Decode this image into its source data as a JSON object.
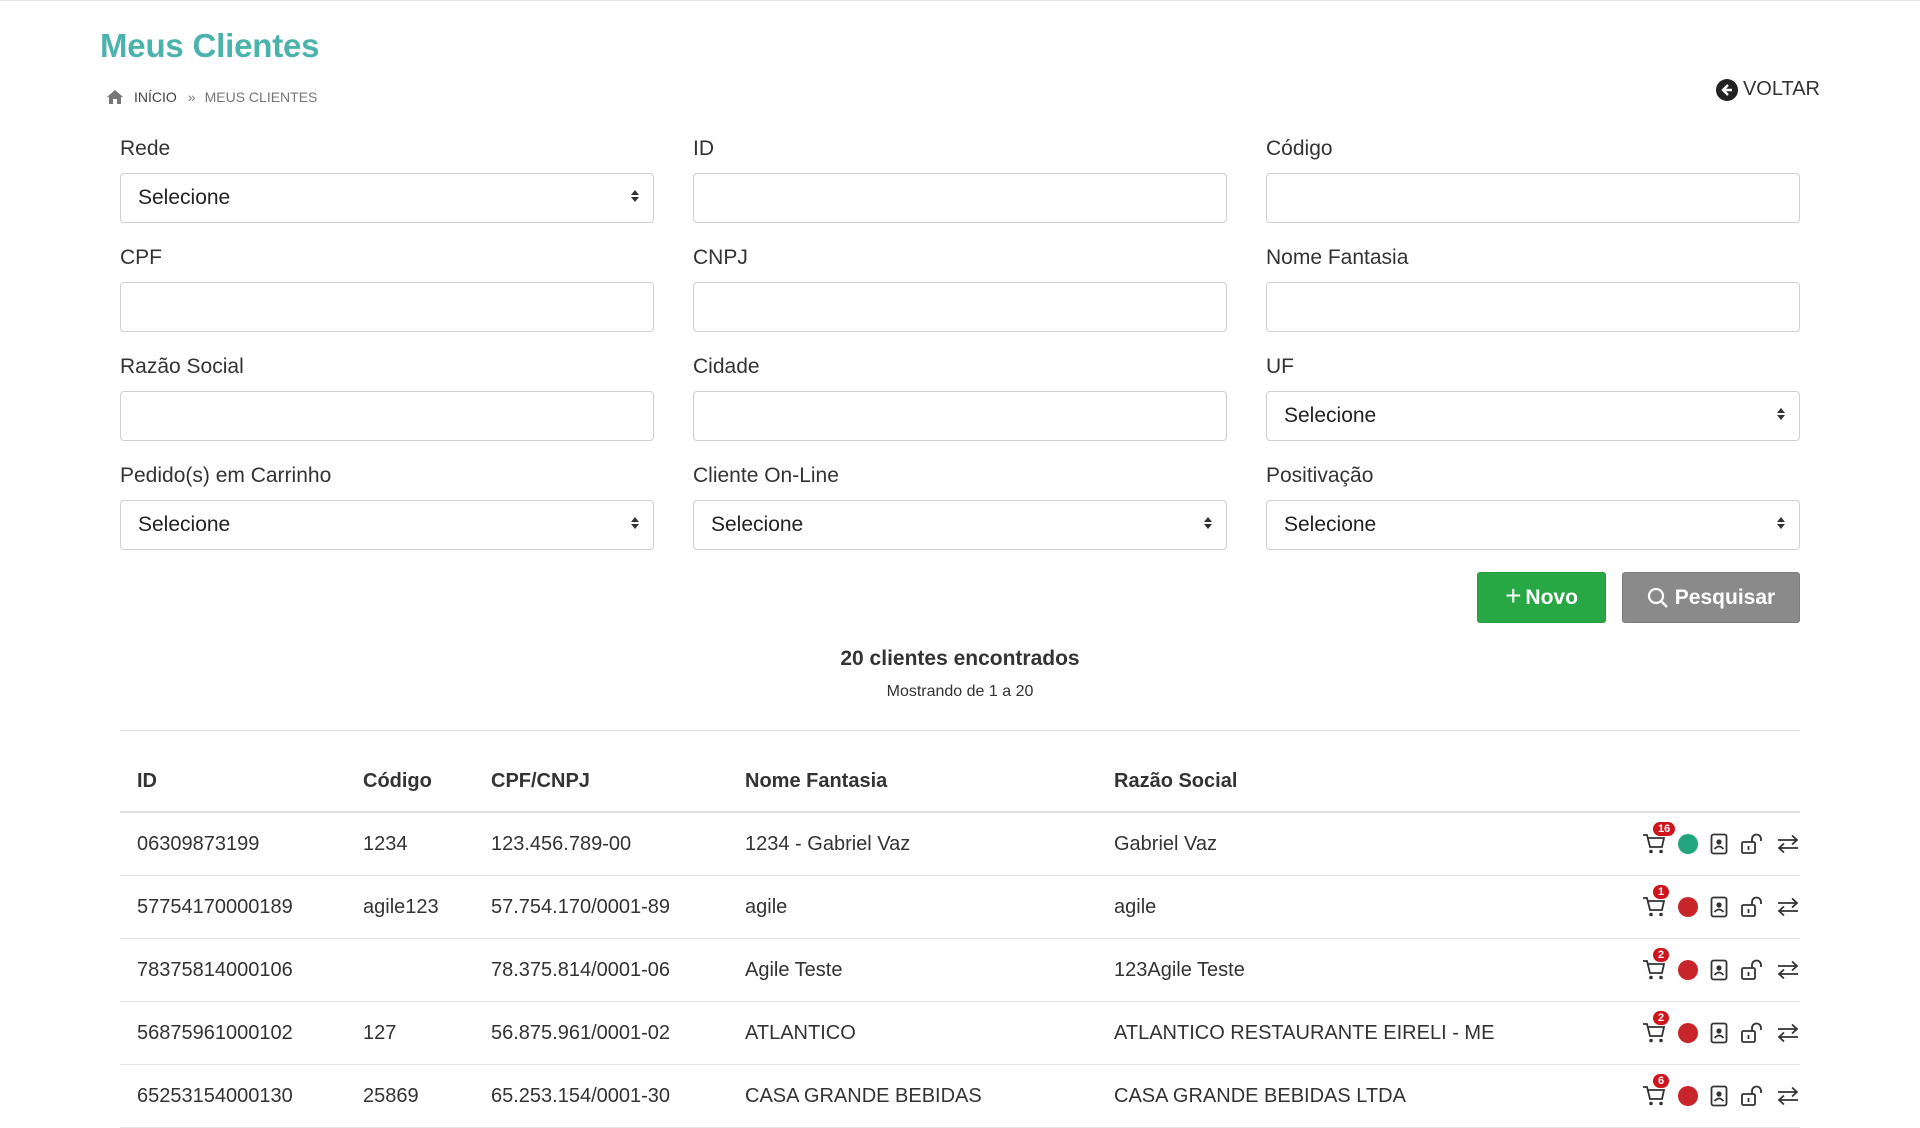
{
  "page": {
    "title": "Meus Clientes"
  },
  "breadcrumb": {
    "home": "INÍCIO",
    "current": "MEUS CLIENTES"
  },
  "back": {
    "label": "VOLTAR"
  },
  "filters": {
    "rede": {
      "label": "Rede",
      "value": "Selecione"
    },
    "id": {
      "label": "ID",
      "value": ""
    },
    "codigo": {
      "label": "Código",
      "value": ""
    },
    "cpf": {
      "label": "CPF",
      "value": ""
    },
    "cnpj": {
      "label": "CNPJ",
      "value": ""
    },
    "nome_fantasia": {
      "label": "Nome Fantasia",
      "value": ""
    },
    "razao_social": {
      "label": "Razão Social",
      "value": ""
    },
    "cidade": {
      "label": "Cidade",
      "value": ""
    },
    "uf": {
      "label": "UF",
      "value": "Selecione"
    },
    "pedidos_carrinho": {
      "label": "Pedido(s) em Carrinho",
      "value": "Selecione"
    },
    "cliente_online": {
      "label": "Cliente On-Line",
      "value": "Selecione"
    },
    "positivacao": {
      "label": "Positivação",
      "value": "Selecione"
    }
  },
  "buttons": {
    "new": "Novo",
    "search": "Pesquisar"
  },
  "results": {
    "count": "20 clientes encontrados",
    "range": "Mostrando de 1 a 20"
  },
  "colors": {
    "title": "#4bb3ab",
    "online": "#20a57f",
    "offline": "#c8252b",
    "badge": "#d0141c",
    "new_button": "#28a745",
    "search_button": "#8a8a8a"
  },
  "table": {
    "headers": [
      "ID",
      "Código",
      "CPF/CNPJ",
      "Nome Fantasia",
      "Razão Social"
    ],
    "rows": [
      {
        "id": "06309873199",
        "codigo": "1234",
        "doc": "123.456.789-00",
        "fantasia": "1234 - Gabriel Vaz",
        "razao": "Gabriel Vaz",
        "cart_count": "16",
        "online": true
      },
      {
        "id": "57754170000189",
        "codigo": "agile123",
        "doc": "57.754.170/0001-89",
        "fantasia": "agile",
        "razao": "agile",
        "cart_count": "1",
        "online": false
      },
      {
        "id": "78375814000106",
        "codigo": "",
        "doc": "78.375.814/0001-06",
        "fantasia": "Agile Teste",
        "razao": "123Agile Teste",
        "cart_count": "2",
        "online": false
      },
      {
        "id": "56875961000102",
        "codigo": "127",
        "doc": "56.875.961/0001-02",
        "fantasia": "ATLANTICO",
        "razao": "ATLANTICO RESTAURANTE EIRELI - ME",
        "cart_count": "2",
        "online": false
      },
      {
        "id": "65253154000130",
        "codigo": "25869",
        "doc": "65.253.154/0001-30",
        "fantasia": "CASA GRANDE BEBIDAS",
        "razao": "CASA GRANDE BEBIDAS LTDA",
        "cart_count": "6",
        "online": false
      }
    ]
  }
}
